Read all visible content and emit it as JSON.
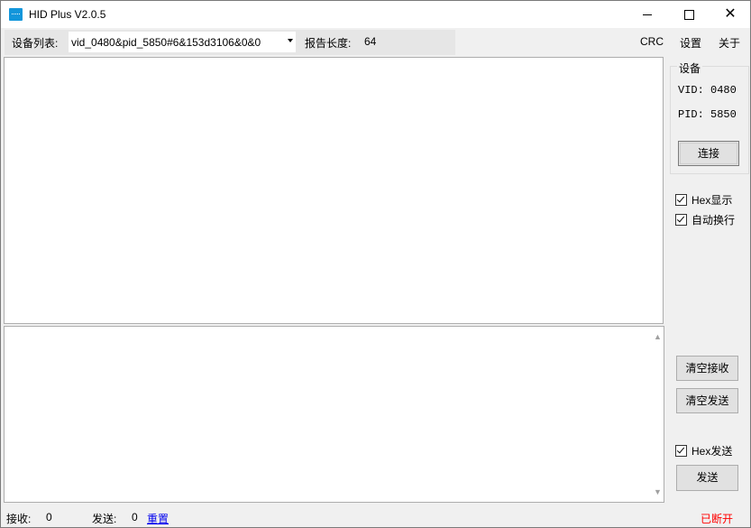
{
  "window": {
    "title": "HID Plus V2.0.5",
    "app_icon": "usb-hid-icon",
    "controls": {
      "minimize": "—",
      "maximize": "☐",
      "close": "✕"
    }
  },
  "toolbar": {
    "device_list_label": "设备列表:",
    "device_selected": "vid_0480&pid_5850#6&153d3106&0&0",
    "report_length_label": "报告长度:",
    "report_length_value": "64"
  },
  "menu": {
    "crc": "CRC",
    "settings": "设置",
    "about": "关于"
  },
  "device_group": {
    "title": "设备",
    "vid": "VID: 0480",
    "pid": "PID: 5850",
    "connect_label": "连接"
  },
  "options": {
    "hex_display": {
      "label": "Hex显示",
      "checked": true
    },
    "auto_wrap": {
      "label": "自动换行",
      "checked": true
    },
    "hex_send": {
      "label": "Hex发送",
      "checked": true
    }
  },
  "buttons": {
    "clear_recv": "清空接收",
    "clear_send": "清空发送",
    "send": "发送"
  },
  "receive_text": "",
  "send_text": "",
  "statusbar": {
    "recv_label": "接收:",
    "recv_count": "0",
    "send_label": "发送:",
    "send_count": "0",
    "reset_label": "重置",
    "connection_status": "已断开"
  },
  "colors": {
    "status_disconnected": "#ff0000",
    "link": "#0000ee",
    "icon_accent": "#1296db"
  }
}
